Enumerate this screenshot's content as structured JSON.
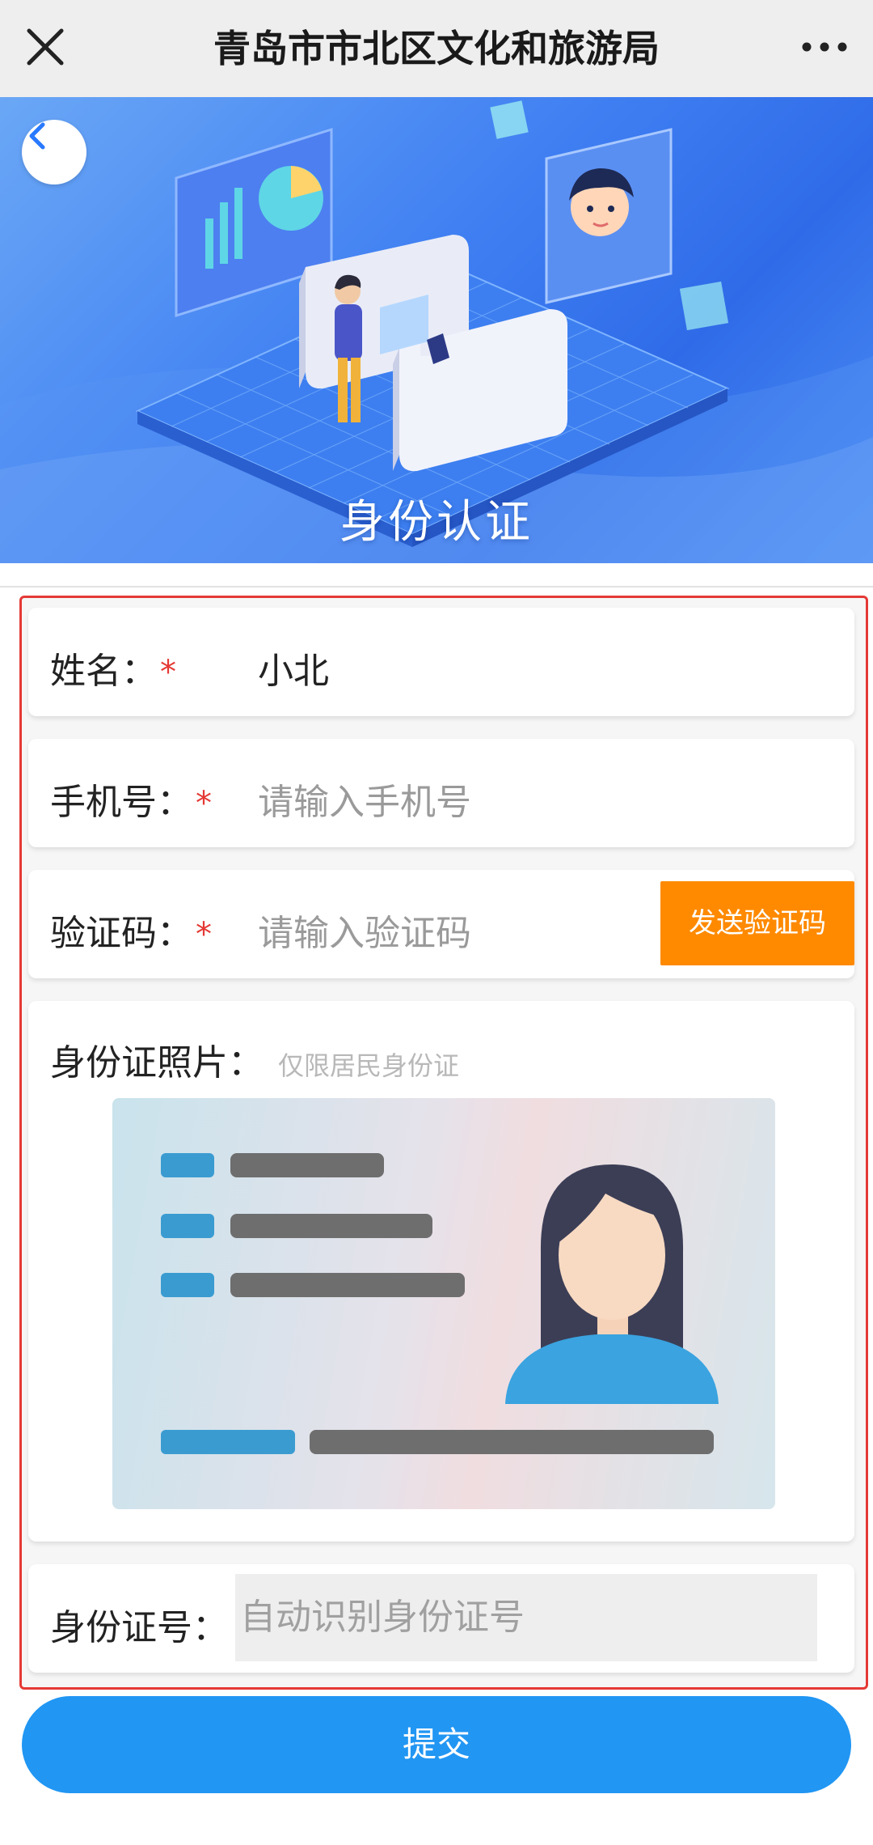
{
  "nav": {
    "title": "青岛市市北区文化和旅游局",
    "close_icon": "close-icon",
    "more_icon": "more-icon"
  },
  "banner": {
    "title": "身份认证",
    "back_icon": "chevron-left-icon"
  },
  "form": {
    "name": {
      "label": "姓名：",
      "required_mark": "*",
      "value": "小北"
    },
    "phone": {
      "label": "手机号：",
      "required_mark": "*",
      "placeholder": "请输入手机号"
    },
    "code": {
      "label": "验证码：",
      "required_mark": "*",
      "placeholder": "请输入验证码",
      "send_label": "发送验证码"
    },
    "id_photo": {
      "label": "身份证照片：",
      "hint": "仅限居民身份证"
    },
    "id_number": {
      "label": "身份证号：",
      "placeholder": "自动识别身份证号"
    }
  },
  "submit_label": "提交",
  "colors": {
    "required": "#e53935",
    "send_button": "#ff8a00",
    "submit_button": "#2196f3",
    "outline": "#e53935"
  }
}
